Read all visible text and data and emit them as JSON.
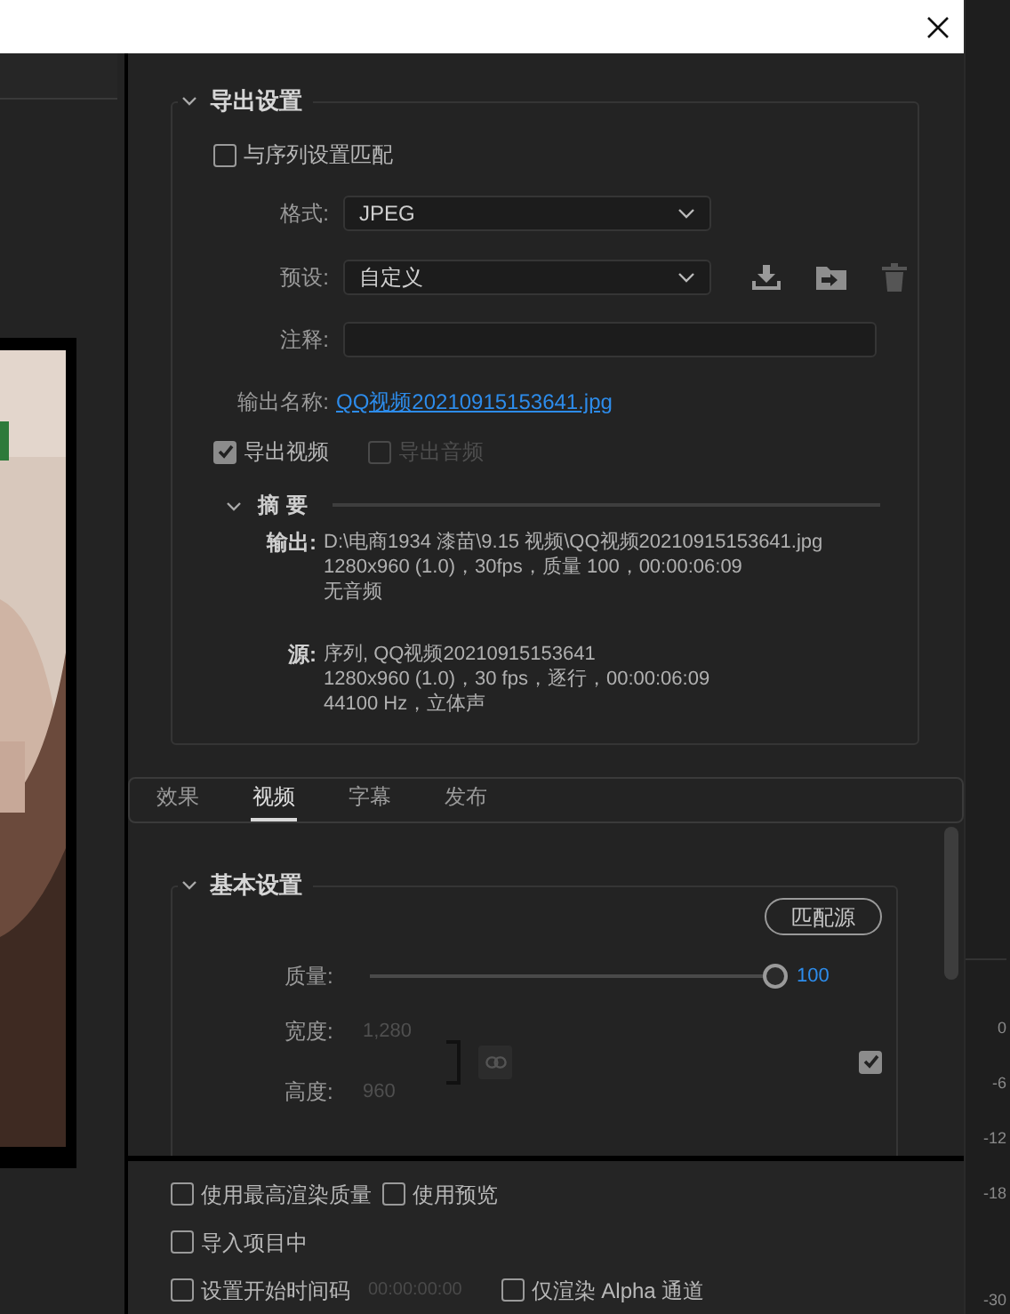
{
  "export_settings": {
    "title": "导出设置",
    "expanded": true,
    "match_sequence": {
      "label": "与序列设置匹配",
      "checked": false
    },
    "format": {
      "label": "格式:",
      "value": "JPEG"
    },
    "preset": {
      "label": "预设:",
      "value": "自定义"
    },
    "comments": {
      "label": "注释:"
    },
    "output_name": {
      "label": "输出名称:",
      "value": "QQ视频20210915153641.jpg"
    },
    "export_options": [
      {
        "label": "导出视频",
        "checked": true,
        "disabled": false
      },
      {
        "label": "导出音频",
        "checked": false,
        "disabled": true
      }
    ],
    "summary": {
      "title": "摘要",
      "expanded": true,
      "entries": [
        {
          "label": "输出:",
          "lines": [
            "D:\\电商1934  漆苗\\9.15 视频\\QQ视频20210915153641.jpg",
            "1280x960 (1.0)，30fps，质量 100，00:00:06:09",
            "无音频"
          ]
        },
        {
          "label": "源:",
          "lines": [
            "序列, QQ视频20210915153641",
            "1280x960 (1.0)，30 fps，逐行，00:00:06:09",
            "44100 Hz，立体声"
          ]
        }
      ]
    }
  },
  "tabs": [
    {
      "label": "效果",
      "selected": false
    },
    {
      "label": "视频",
      "selected": true
    },
    {
      "label": "字幕",
      "selected": false
    },
    {
      "label": "发布",
      "selected": false
    }
  ],
  "basic_settings": {
    "title": "基本设置",
    "expanded": true,
    "match_source": "匹配源",
    "quality": {
      "label": "质量:",
      "level": 1.0,
      "reading": "100"
    },
    "width": {
      "label": "宽度:",
      "value": "1,280"
    },
    "height": {
      "label": "高度:",
      "value": "960"
    },
    "constrain": {
      "checked": true
    }
  },
  "render_options": [
    [
      {
        "label": "使用最高渲染质量",
        "checked": false
      },
      {
        "label": "使用预览",
        "checked": false
      }
    ],
    [
      {
        "label": "导入项目中",
        "checked": false
      }
    ],
    [
      {
        "label": "设置开始时间码",
        "checked": false,
        "timecode": "00:00:00:00"
      },
      {
        "label": "仅渲染 Alpha 通道",
        "checked": false
      }
    ]
  ],
  "meter": {
    "labels": [
      "0",
      "-6",
      "-12",
      "-18",
      "-30"
    ]
  }
}
